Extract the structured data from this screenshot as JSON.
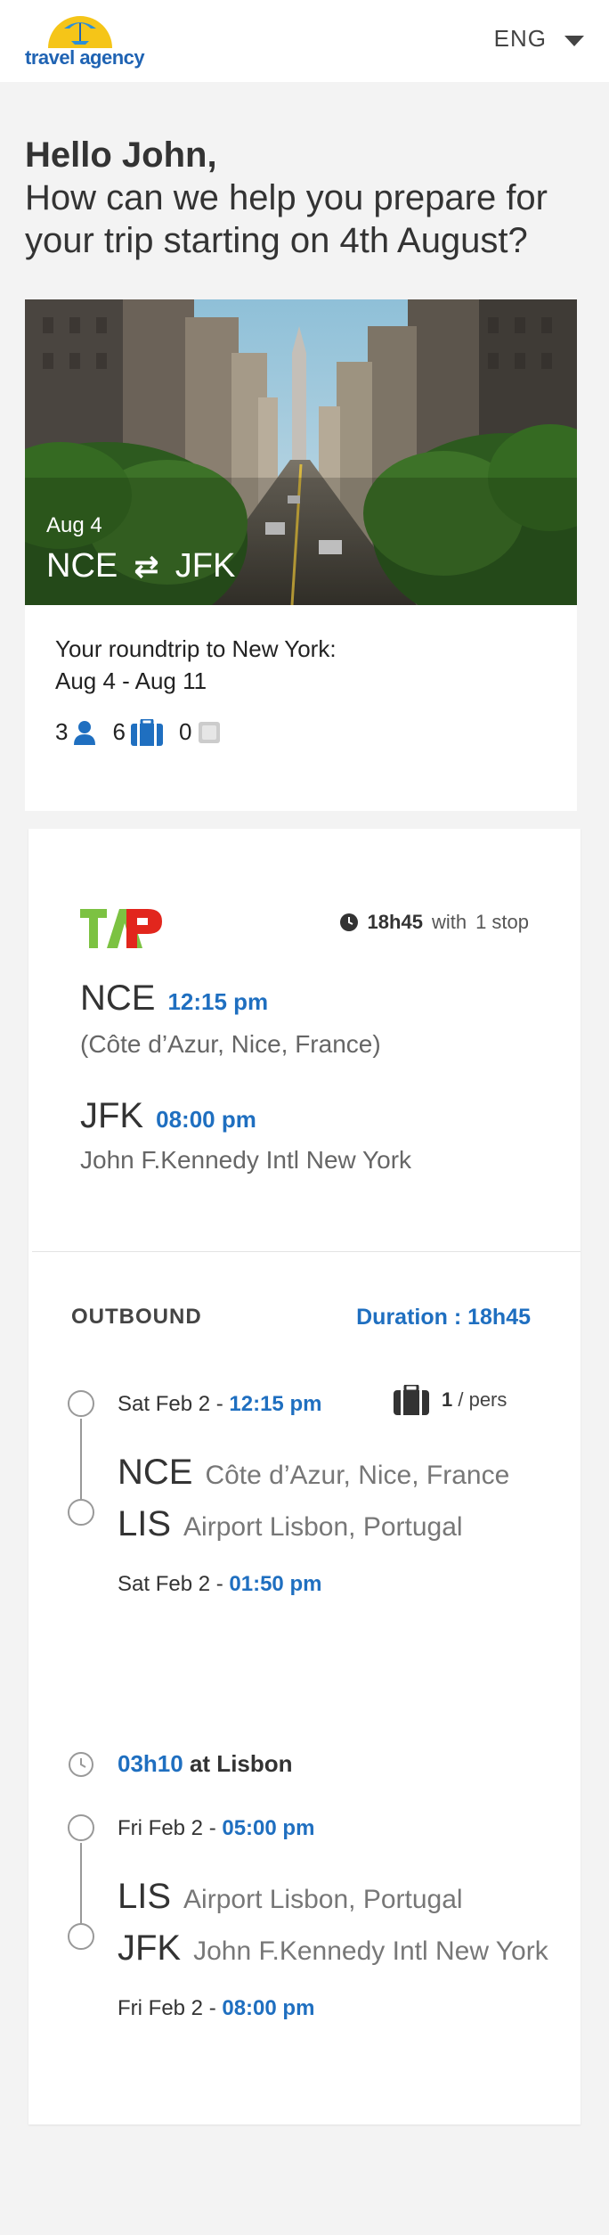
{
  "header": {
    "logo_text": "travel agency",
    "language": "ENG"
  },
  "greeting": {
    "hello": "Hello John,",
    "question": "How can we help you prepare for your trip starting on 4th August?"
  },
  "trip": {
    "image_date": "Aug 4",
    "from": "NCE",
    "to": "JFK",
    "title": "Your roundtrip to New York:",
    "dates": "Aug 4 - Aug 11",
    "passengers": "3",
    "bags": "6",
    "other": "0"
  },
  "flight": {
    "airline": "TAP",
    "duration": "18h45",
    "duration_with": "with",
    "stops": "1 stop",
    "depart": {
      "code": "NCE",
      "time": "12:15 pm",
      "place": "(Côte d’Azur, Nice, France)"
    },
    "arrive": {
      "code": "JFK",
      "time": "08:00 pm",
      "place": "John F.Kennedy Intl New York"
    },
    "outbound_label": "OUTBOUND",
    "outbound_duration": "Duration : 18h45",
    "legs": [
      {
        "dep_date": "Sat Feb 2 - ",
        "dep_time": "12:15 pm",
        "bag_count": "1",
        "bag_unit": " / pers",
        "from_code": "NCE",
        "from_place": "Côte d’Azur, Nice, France",
        "to_code": "LIS",
        "to_place": "Airport Lisbon, Portugal",
        "arr_date": "Sat Feb 2 - ",
        "arr_time": "01:50 pm"
      },
      {
        "dep_date": "Fri Feb 2 - ",
        "dep_time": "05:00 pm",
        "from_code": "LIS",
        "from_place": "Airport Lisbon, Portugal",
        "to_code": "JFK",
        "to_place": "John F.Kennedy Intl New York",
        "arr_date": "Fri Feb 2 - ",
        "arr_time": "08:00 pm"
      }
    ],
    "layover": {
      "time": "03h10",
      "place": "at Lisbon"
    }
  },
  "colors": {
    "accent_blue": "#1f6fc0",
    "logo_blue": "#1f63b3",
    "logo_yellow": "#f5c518",
    "tap_green": "#7cc242",
    "tap_red": "#e2261d"
  }
}
